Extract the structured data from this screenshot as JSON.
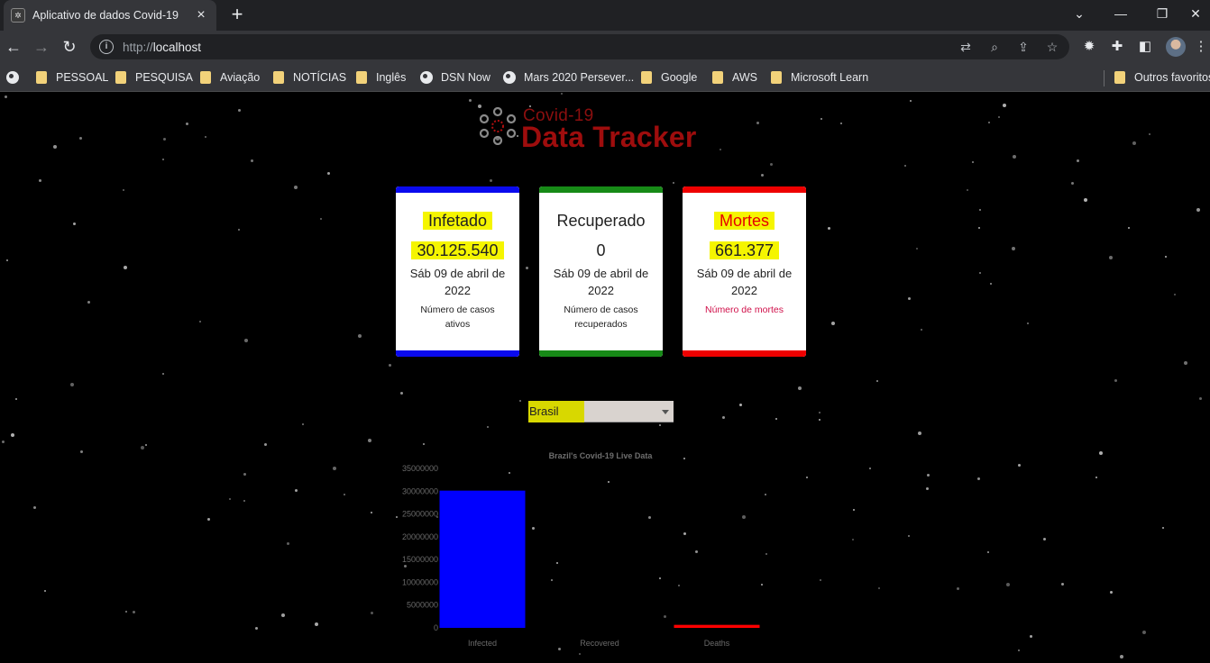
{
  "browser": {
    "tab_title": "Aplicativo de dados Covid-19",
    "url_prefix": "http://",
    "url_host": "localhost",
    "bookmarks": [
      {
        "label": "PESSOAL",
        "icon": "folder-icon"
      },
      {
        "label": "PESQUISA",
        "icon": "folder-icon"
      },
      {
        "label": "Aviação",
        "icon": "folder-icon"
      },
      {
        "label": "NOTÍCIAS",
        "icon": "folder-icon"
      },
      {
        "label": "Inglês",
        "icon": "folder-icon"
      },
      {
        "label": "DSN Now",
        "icon": "globe-icon"
      },
      {
        "label": "Mars 2020 Persever...",
        "icon": "globe-icon"
      },
      {
        "label": "Google",
        "icon": "folder-icon"
      },
      {
        "label": "AWS",
        "icon": "folder-icon"
      },
      {
        "label": "Microsoft Learn",
        "icon": "folder-icon"
      }
    ],
    "other_bookmarks": "Outros favoritos"
  },
  "logo": {
    "small": "Covid-19",
    "big": "Data Tracker"
  },
  "cards": {
    "infected": {
      "title": "Infetado",
      "value": "30.125.540",
      "date": "Sáb 09 de abril de 2022",
      "desc": "Número de casos ativos",
      "accent": "#0a0aee"
    },
    "recovered": {
      "title": "Recuperado",
      "value": "0",
      "date": "Sáb 09 de abril de 2022",
      "desc": "Número de casos recuperados",
      "accent": "#178a17"
    },
    "deaths": {
      "title": "Mortes",
      "value": "661.377",
      "date": "Sáb 09 de abril de 2022",
      "desc": "Número de mortes",
      "accent": "#ee0000"
    }
  },
  "country_select": {
    "selected": "Brasil"
  },
  "chart_data": {
    "type": "bar",
    "title": "Brazil's Covid-19 Live Data",
    "categories": [
      "Infected",
      "Recovered",
      "Deaths"
    ],
    "values": [
      30125540,
      0,
      661377
    ],
    "colors": [
      "#0000ff",
      "#00aa00",
      "#ff0000"
    ],
    "ylim": [
      0,
      35000000
    ],
    "yticks": [
      "0",
      "5000000",
      "10000000",
      "15000000",
      "20000000",
      "25000000",
      "30000000",
      "35000000"
    ],
    "legend": "none",
    "grid": false
  }
}
